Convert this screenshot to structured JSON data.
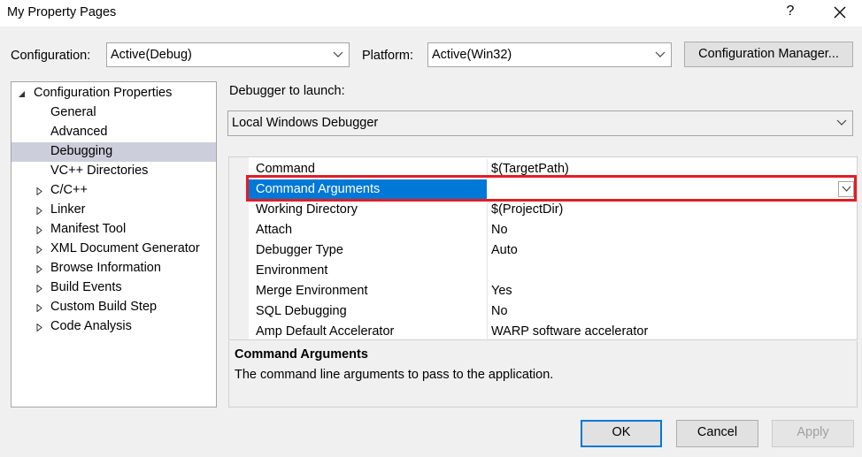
{
  "window": {
    "title": "My Property Pages",
    "help_label": "?"
  },
  "header": {
    "configuration_label": "Configuration:",
    "configuration_value": "Active(Debug)",
    "platform_label": "Platform:",
    "platform_value": "Active(Win32)",
    "config_manager_label": "Configuration Manager..."
  },
  "tree": {
    "root": "Configuration Properties",
    "items": [
      {
        "label": "General"
      },
      {
        "label": "Advanced"
      },
      {
        "label": "Debugging"
      },
      {
        "label": "VC++ Directories"
      },
      {
        "label": "C/C++"
      },
      {
        "label": "Linker"
      },
      {
        "label": "Manifest Tool"
      },
      {
        "label": "XML Document Generator"
      },
      {
        "label": "Browse Information"
      },
      {
        "label": "Build Events"
      },
      {
        "label": "Custom Build Step"
      },
      {
        "label": "Code Analysis"
      }
    ],
    "selected": "Debugging"
  },
  "debugger": {
    "launch_label": "Debugger to launch:",
    "launch_value": "Local Windows Debugger"
  },
  "properties": [
    {
      "name": "Command",
      "value": "$(TargetPath)"
    },
    {
      "name": "Command Arguments",
      "value": ""
    },
    {
      "name": "Working Directory",
      "value": "$(ProjectDir)"
    },
    {
      "name": "Attach",
      "value": "No"
    },
    {
      "name": "Debugger Type",
      "value": "Auto"
    },
    {
      "name": "Environment",
      "value": ""
    },
    {
      "name": "Merge Environment",
      "value": "Yes"
    },
    {
      "name": "SQL Debugging",
      "value": "No"
    },
    {
      "name": "Amp Default Accelerator",
      "value": "WARP software accelerator"
    }
  ],
  "selected_property": "Command Arguments",
  "description": {
    "title": "Command Arguments",
    "text": "The command line arguments to pass to the application."
  },
  "buttons": {
    "ok": "OK",
    "cancel": "Cancel",
    "apply": "Apply"
  },
  "colors": {
    "accent": "#0078d7",
    "highlight_border": "#e21d25",
    "tree_selection": "#cccedb"
  }
}
